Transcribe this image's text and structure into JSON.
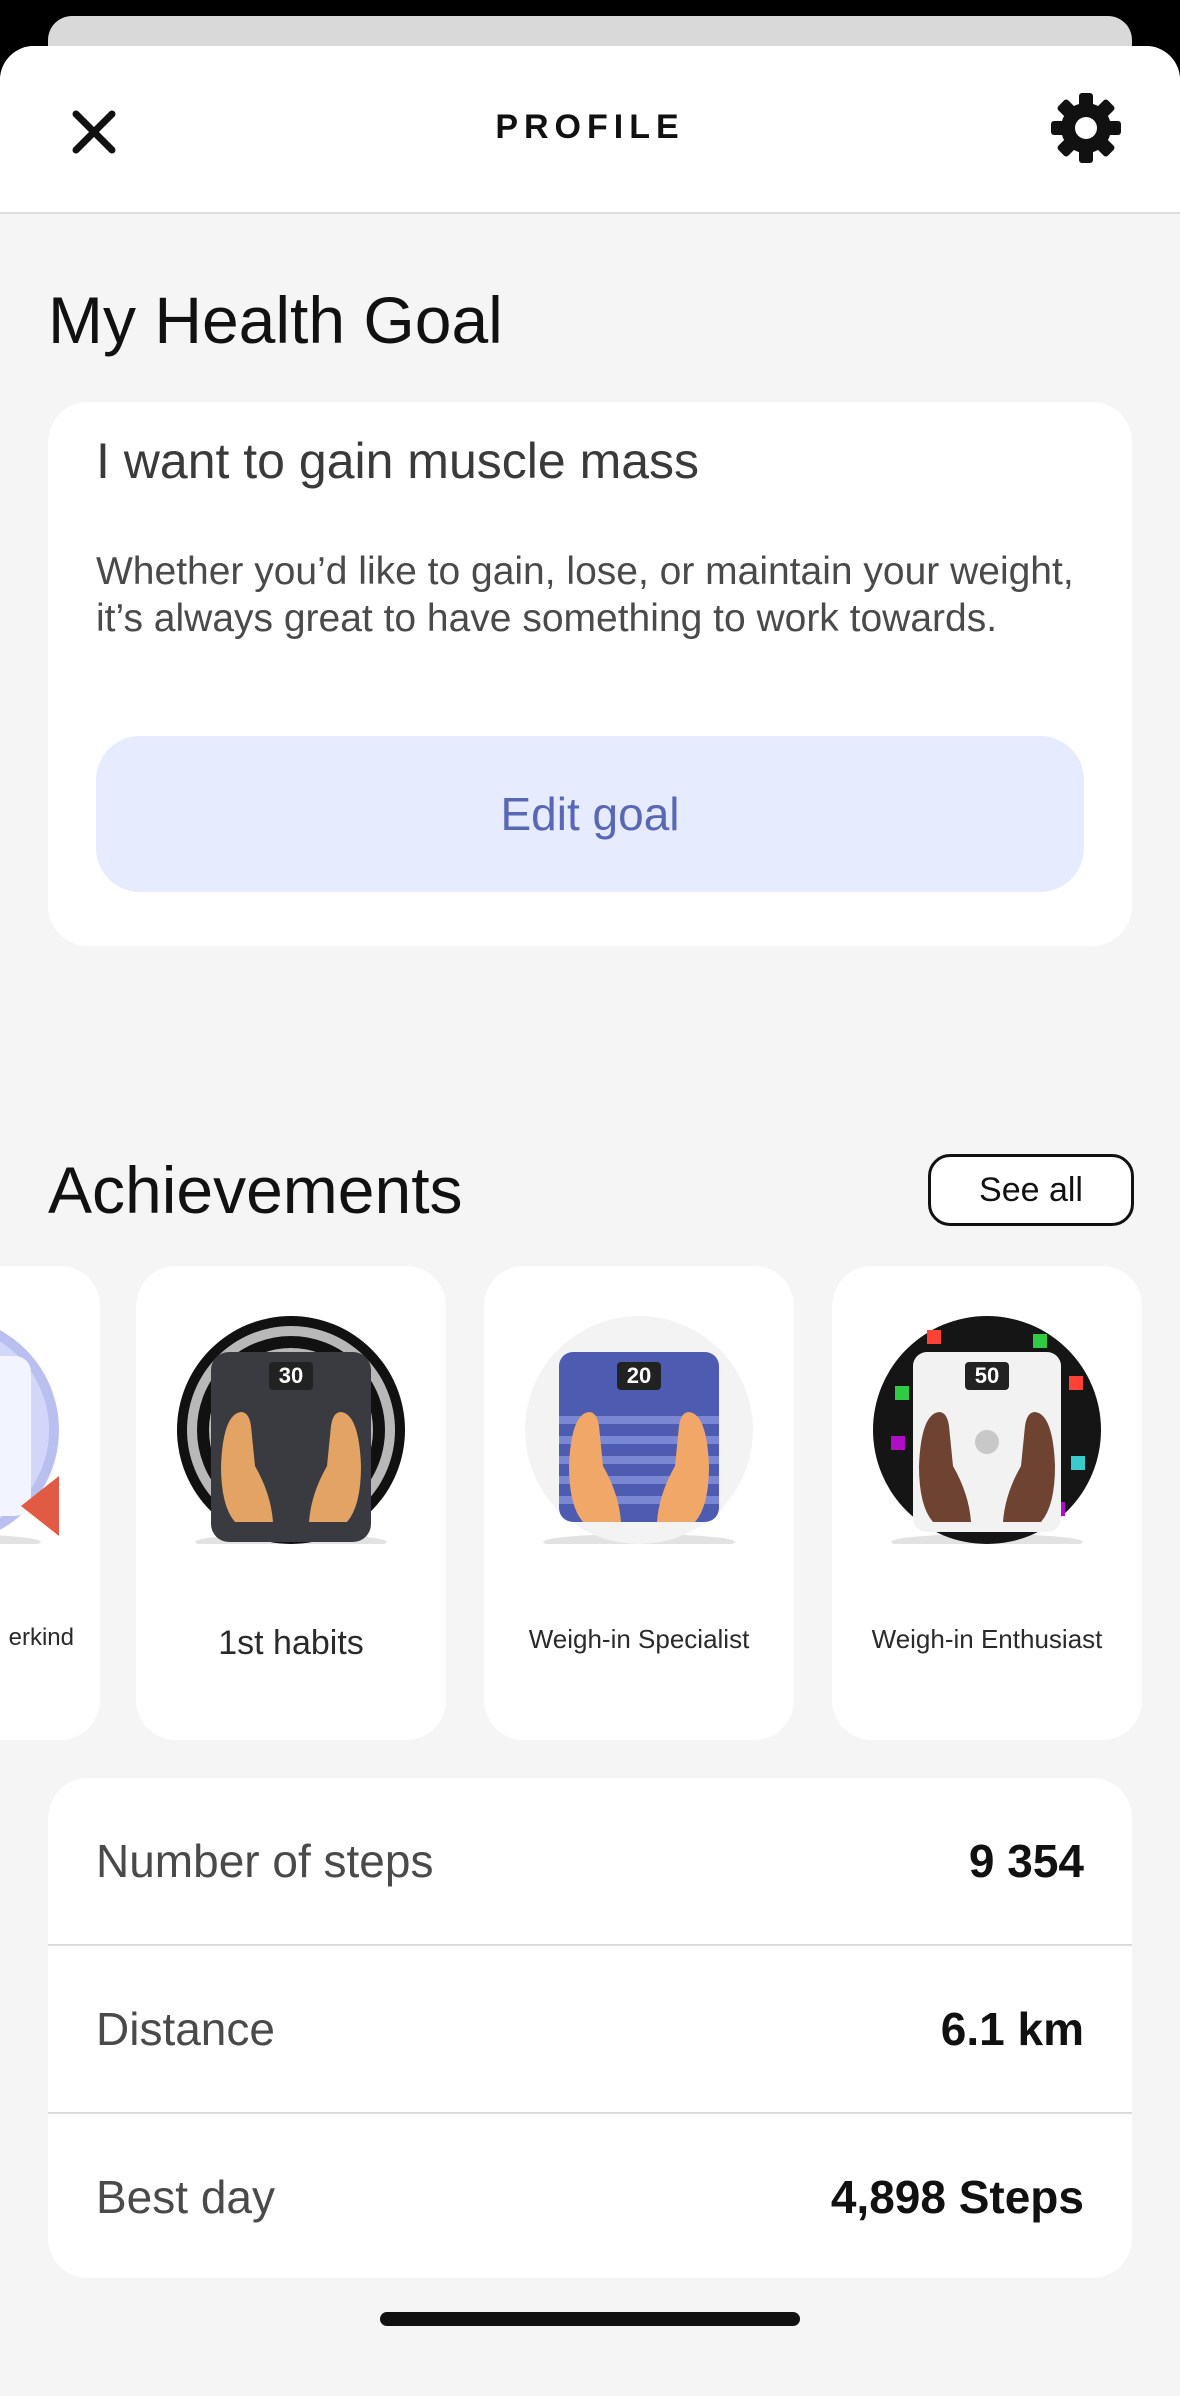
{
  "header": {
    "title": "PROFILE",
    "close_icon": "close-icon",
    "settings_icon": "gear-icon"
  },
  "health_goal": {
    "section_title": "My Health Goal",
    "heading": "I want to gain muscle mass",
    "description": "Whether you’d like to gain, lose, or maintain your weight, it’s always great to have something to work towards.",
    "edit_button_label": "Edit goal"
  },
  "achievements": {
    "section_title": "Achievements",
    "see_all_label": "See all",
    "items": [
      {
        "label": "erkind",
        "badge_number": ""
      },
      {
        "label": "1st habits",
        "badge_number": "30"
      },
      {
        "label": "Weigh-in Specialist",
        "badge_number": "20"
      },
      {
        "label": "Weigh-in Enthusiast",
        "badge_number": "50"
      }
    ]
  },
  "stats": [
    {
      "label": "Number of steps",
      "value": "9 354"
    },
    {
      "label": "Distance",
      "value": "6.1 km"
    },
    {
      "label": "Best day",
      "value": "4,898 Steps"
    }
  ],
  "colors": {
    "accent_button_bg": "#e6ebfd",
    "accent_button_text": "#5868b4",
    "page_background": "#f5f5f5"
  }
}
